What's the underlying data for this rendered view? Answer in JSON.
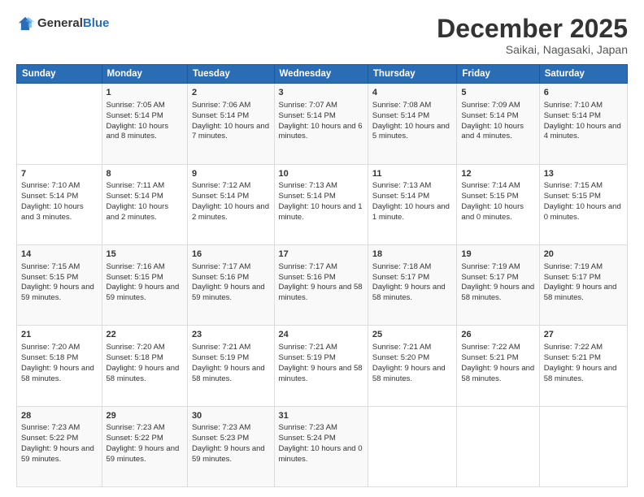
{
  "logo": {
    "general": "General",
    "blue": "Blue"
  },
  "header": {
    "month": "December 2025",
    "location": "Saikai, Nagasaki, Japan"
  },
  "days_of_week": [
    "Sunday",
    "Monday",
    "Tuesday",
    "Wednesday",
    "Thursday",
    "Friday",
    "Saturday"
  ],
  "weeks": [
    [
      {
        "day": "",
        "sunrise": "",
        "sunset": "",
        "daylight": ""
      },
      {
        "day": "1",
        "sunrise": "Sunrise: 7:05 AM",
        "sunset": "Sunset: 5:14 PM",
        "daylight": "Daylight: 10 hours and 8 minutes."
      },
      {
        "day": "2",
        "sunrise": "Sunrise: 7:06 AM",
        "sunset": "Sunset: 5:14 PM",
        "daylight": "Daylight: 10 hours and 7 minutes."
      },
      {
        "day": "3",
        "sunrise": "Sunrise: 7:07 AM",
        "sunset": "Sunset: 5:14 PM",
        "daylight": "Daylight: 10 hours and 6 minutes."
      },
      {
        "day": "4",
        "sunrise": "Sunrise: 7:08 AM",
        "sunset": "Sunset: 5:14 PM",
        "daylight": "Daylight: 10 hours and 5 minutes."
      },
      {
        "day": "5",
        "sunrise": "Sunrise: 7:09 AM",
        "sunset": "Sunset: 5:14 PM",
        "daylight": "Daylight: 10 hours and 4 minutes."
      },
      {
        "day": "6",
        "sunrise": "Sunrise: 7:10 AM",
        "sunset": "Sunset: 5:14 PM",
        "daylight": "Daylight: 10 hours and 4 minutes."
      }
    ],
    [
      {
        "day": "7",
        "sunrise": "Sunrise: 7:10 AM",
        "sunset": "Sunset: 5:14 PM",
        "daylight": "Daylight: 10 hours and 3 minutes."
      },
      {
        "day": "8",
        "sunrise": "Sunrise: 7:11 AM",
        "sunset": "Sunset: 5:14 PM",
        "daylight": "Daylight: 10 hours and 2 minutes."
      },
      {
        "day": "9",
        "sunrise": "Sunrise: 7:12 AM",
        "sunset": "Sunset: 5:14 PM",
        "daylight": "Daylight: 10 hours and 2 minutes."
      },
      {
        "day": "10",
        "sunrise": "Sunrise: 7:13 AM",
        "sunset": "Sunset: 5:14 PM",
        "daylight": "Daylight: 10 hours and 1 minute."
      },
      {
        "day": "11",
        "sunrise": "Sunrise: 7:13 AM",
        "sunset": "Sunset: 5:14 PM",
        "daylight": "Daylight: 10 hours and 1 minute."
      },
      {
        "day": "12",
        "sunrise": "Sunrise: 7:14 AM",
        "sunset": "Sunset: 5:15 PM",
        "daylight": "Daylight: 10 hours and 0 minutes."
      },
      {
        "day": "13",
        "sunrise": "Sunrise: 7:15 AM",
        "sunset": "Sunset: 5:15 PM",
        "daylight": "Daylight: 10 hours and 0 minutes."
      }
    ],
    [
      {
        "day": "14",
        "sunrise": "Sunrise: 7:15 AM",
        "sunset": "Sunset: 5:15 PM",
        "daylight": "Daylight: 9 hours and 59 minutes."
      },
      {
        "day": "15",
        "sunrise": "Sunrise: 7:16 AM",
        "sunset": "Sunset: 5:15 PM",
        "daylight": "Daylight: 9 hours and 59 minutes."
      },
      {
        "day": "16",
        "sunrise": "Sunrise: 7:17 AM",
        "sunset": "Sunset: 5:16 PM",
        "daylight": "Daylight: 9 hours and 59 minutes."
      },
      {
        "day": "17",
        "sunrise": "Sunrise: 7:17 AM",
        "sunset": "Sunset: 5:16 PM",
        "daylight": "Daylight: 9 hours and 58 minutes."
      },
      {
        "day": "18",
        "sunrise": "Sunrise: 7:18 AM",
        "sunset": "Sunset: 5:17 PM",
        "daylight": "Daylight: 9 hours and 58 minutes."
      },
      {
        "day": "19",
        "sunrise": "Sunrise: 7:19 AM",
        "sunset": "Sunset: 5:17 PM",
        "daylight": "Daylight: 9 hours and 58 minutes."
      },
      {
        "day": "20",
        "sunrise": "Sunrise: 7:19 AM",
        "sunset": "Sunset: 5:17 PM",
        "daylight": "Daylight: 9 hours and 58 minutes."
      }
    ],
    [
      {
        "day": "21",
        "sunrise": "Sunrise: 7:20 AM",
        "sunset": "Sunset: 5:18 PM",
        "daylight": "Daylight: 9 hours and 58 minutes."
      },
      {
        "day": "22",
        "sunrise": "Sunrise: 7:20 AM",
        "sunset": "Sunset: 5:18 PM",
        "daylight": "Daylight: 9 hours and 58 minutes."
      },
      {
        "day": "23",
        "sunrise": "Sunrise: 7:21 AM",
        "sunset": "Sunset: 5:19 PM",
        "daylight": "Daylight: 9 hours and 58 minutes."
      },
      {
        "day": "24",
        "sunrise": "Sunrise: 7:21 AM",
        "sunset": "Sunset: 5:19 PM",
        "daylight": "Daylight: 9 hours and 58 minutes."
      },
      {
        "day": "25",
        "sunrise": "Sunrise: 7:21 AM",
        "sunset": "Sunset: 5:20 PM",
        "daylight": "Daylight: 9 hours and 58 minutes."
      },
      {
        "day": "26",
        "sunrise": "Sunrise: 7:22 AM",
        "sunset": "Sunset: 5:21 PM",
        "daylight": "Daylight: 9 hours and 58 minutes."
      },
      {
        "day": "27",
        "sunrise": "Sunrise: 7:22 AM",
        "sunset": "Sunset: 5:21 PM",
        "daylight": "Daylight: 9 hours and 58 minutes."
      }
    ],
    [
      {
        "day": "28",
        "sunrise": "Sunrise: 7:23 AM",
        "sunset": "Sunset: 5:22 PM",
        "daylight": "Daylight: 9 hours and 59 minutes."
      },
      {
        "day": "29",
        "sunrise": "Sunrise: 7:23 AM",
        "sunset": "Sunset: 5:22 PM",
        "daylight": "Daylight: 9 hours and 59 minutes."
      },
      {
        "day": "30",
        "sunrise": "Sunrise: 7:23 AM",
        "sunset": "Sunset: 5:23 PM",
        "daylight": "Daylight: 9 hours and 59 minutes."
      },
      {
        "day": "31",
        "sunrise": "Sunrise: 7:23 AM",
        "sunset": "Sunset: 5:24 PM",
        "daylight": "Daylight: 10 hours and 0 minutes."
      },
      {
        "day": "",
        "sunrise": "",
        "sunset": "",
        "daylight": ""
      },
      {
        "day": "",
        "sunrise": "",
        "sunset": "",
        "daylight": ""
      },
      {
        "day": "",
        "sunrise": "",
        "sunset": "",
        "daylight": ""
      }
    ]
  ]
}
